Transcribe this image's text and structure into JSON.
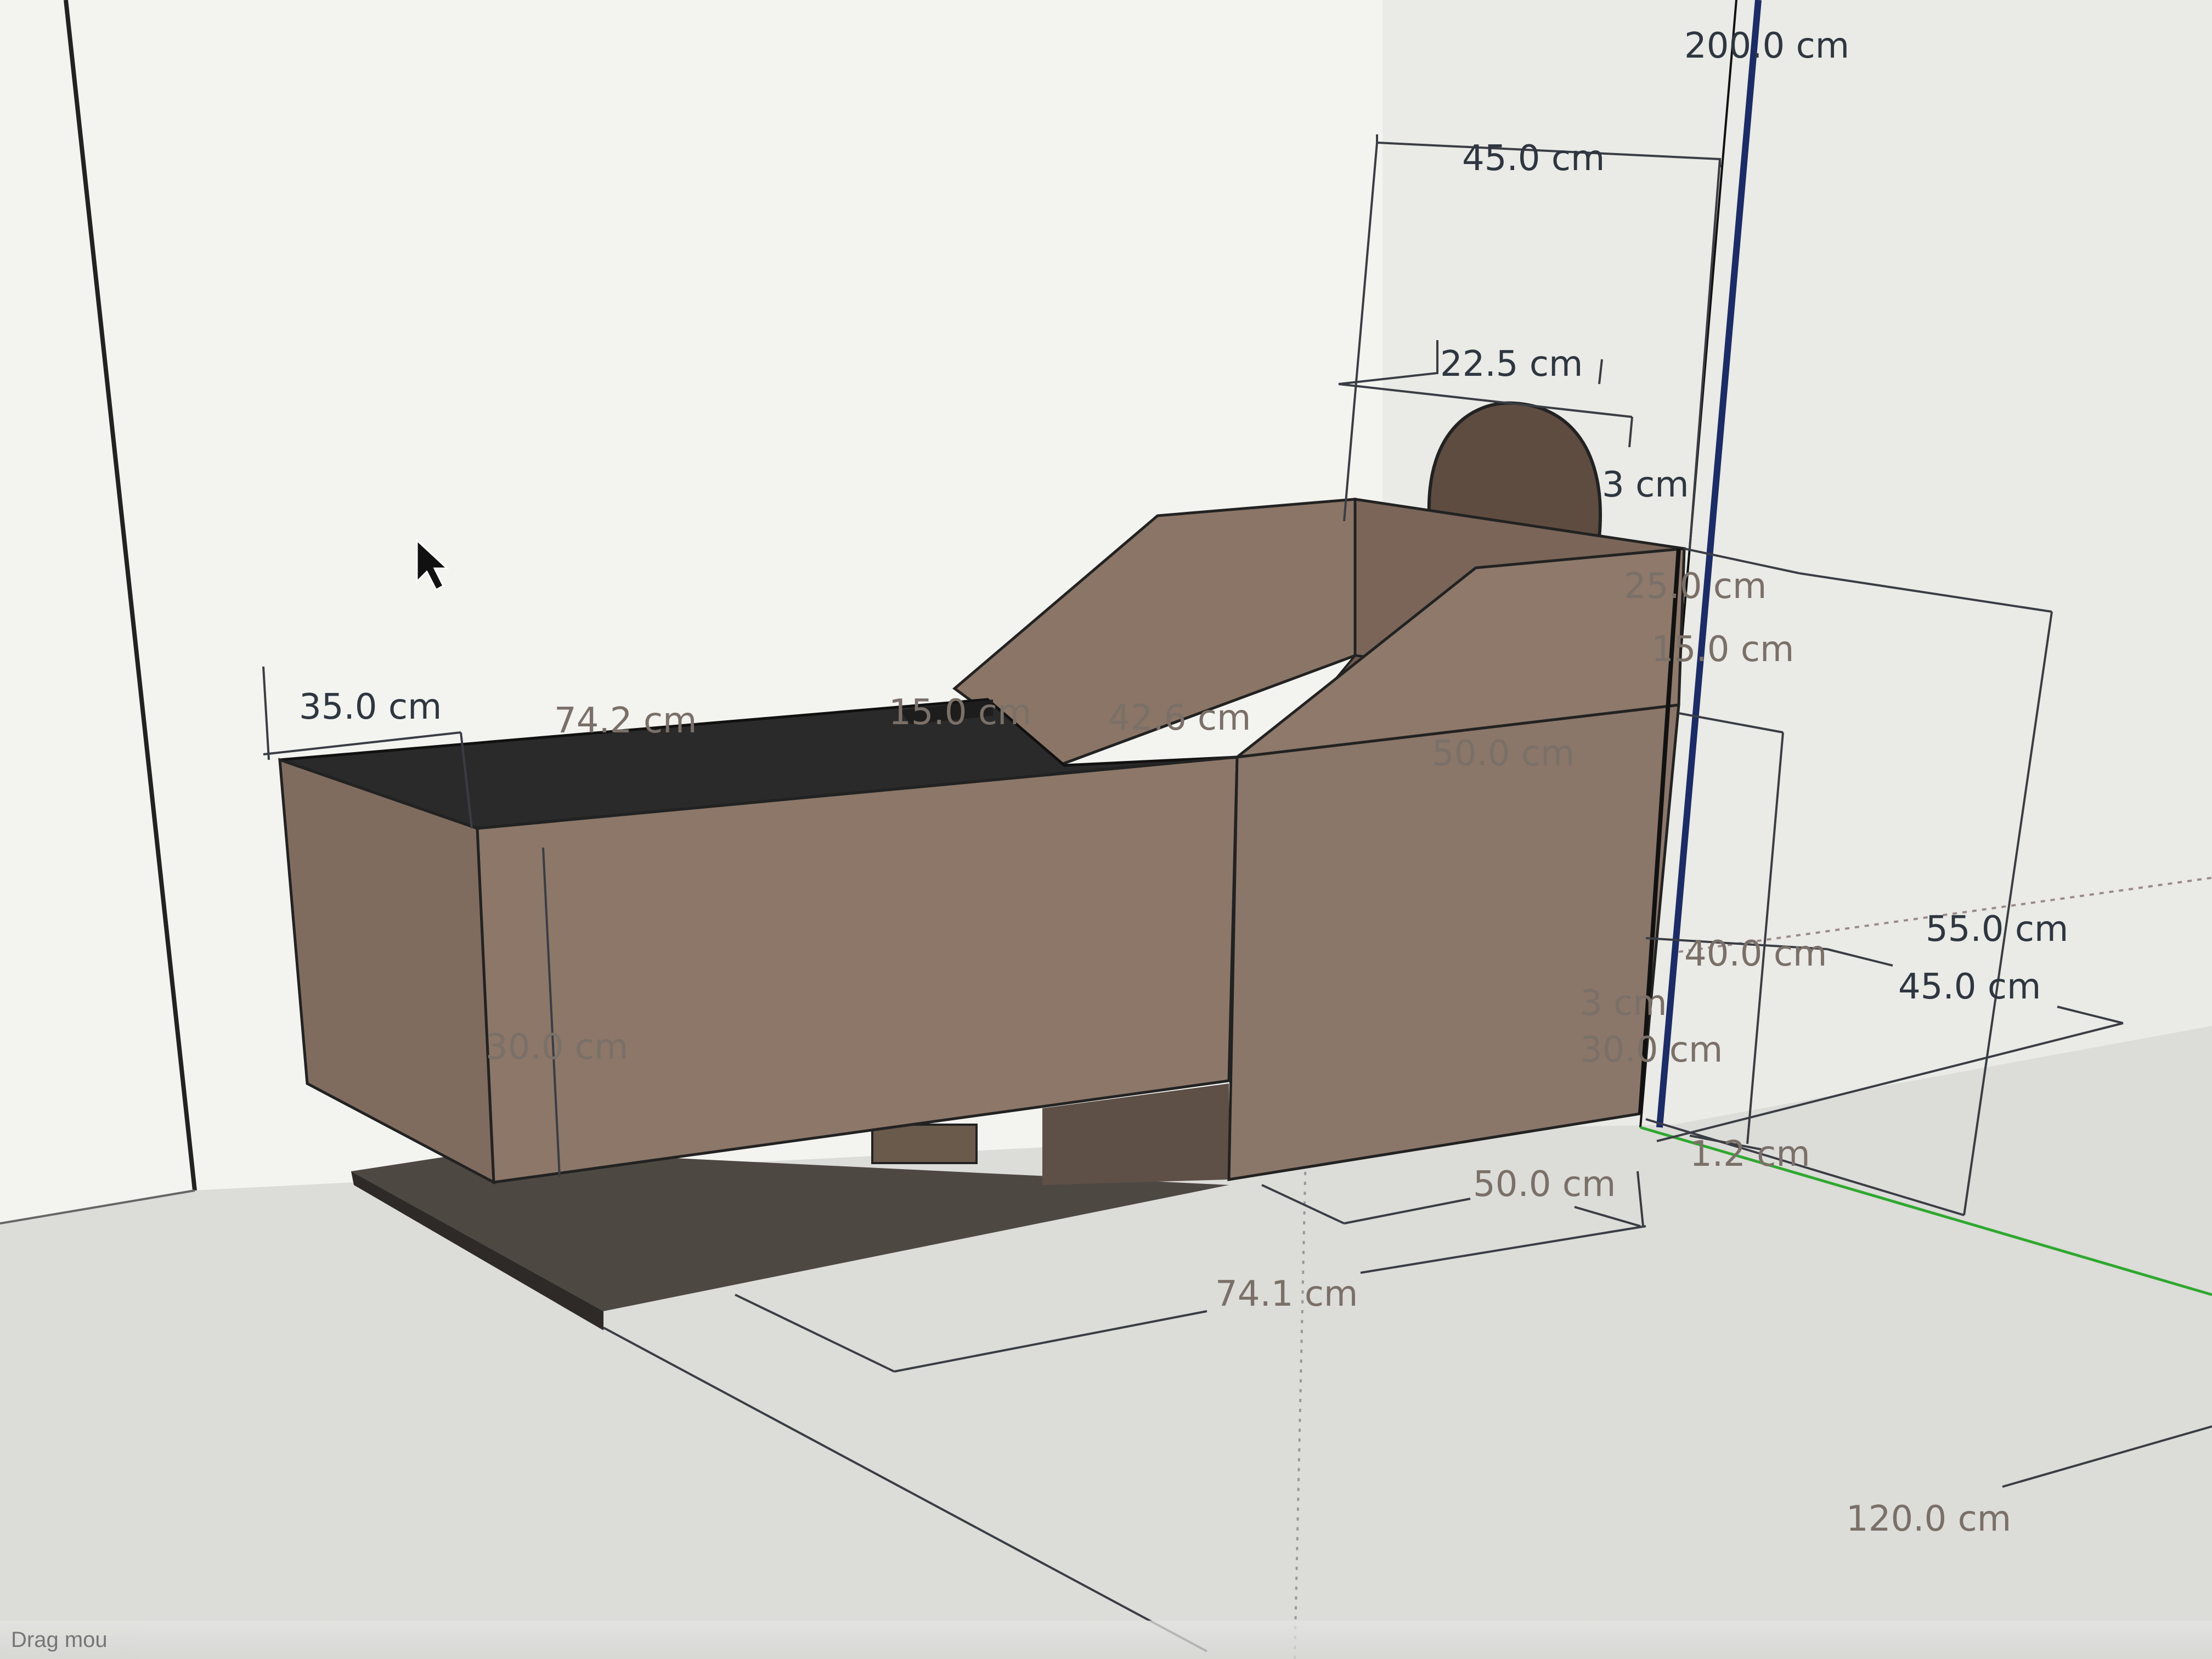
{
  "status_bar": {
    "text": "Drag mou"
  },
  "dimensions": {
    "overall_height": "200.0 cm",
    "top_width": "45.0 cm",
    "head_width": "22.5 cm",
    "head_offset": "3 cm",
    "backrest_depth": "25.0 cm",
    "backrest_height": "15.0 cm",
    "seat_front_width": "35.0 cm",
    "box_length": "74.2 cm",
    "slot_width": "15.0 cm",
    "seat_depth": "42.6 cm",
    "body_width": "50.0 cm",
    "front_height": "30.0 cm",
    "side_height_a": "40.0 cm",
    "side_height_b": "55.0 cm",
    "side_depth": "45.0 cm",
    "small_a": "3 cm",
    "small_b": "30.0 cm",
    "base_thickness": "1.2 cm",
    "base_width": "50.0 cm",
    "base_length": "74.1 cm",
    "floor_length": "120.0 cm"
  },
  "colors": {
    "wall": "#f1f1ee",
    "floor": "#dcdcd8",
    "model_face": "#8a7465",
    "model_top": "#2c2c2c",
    "axis_green": "#2fa830",
    "dim_line": "#3a3d44"
  }
}
